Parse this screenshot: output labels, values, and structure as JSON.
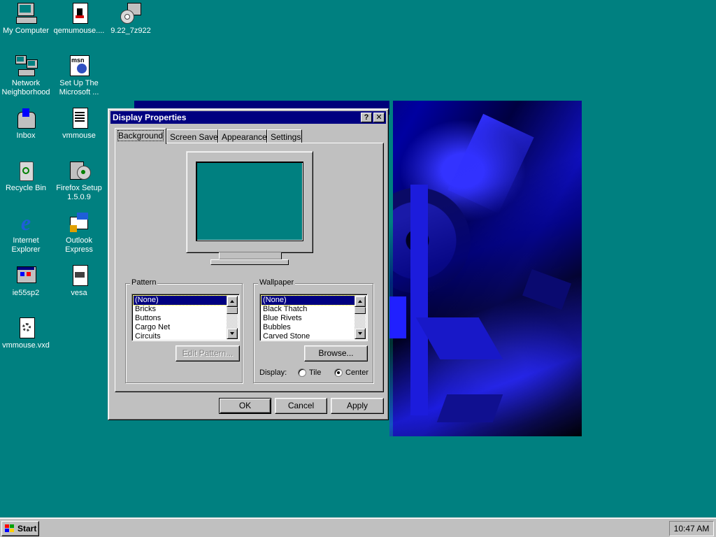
{
  "desktop": {
    "icons": [
      {
        "label": "My Computer",
        "icon": "my-computer-icon"
      },
      {
        "label": "qemumouse....",
        "icon": "document-icon"
      },
      {
        "label": "9.22_7z922",
        "icon": "installer-icon"
      },
      {
        "label": "Network Neighborhood",
        "icon": "network-icon"
      },
      {
        "label": "Set Up The Microsoft ...",
        "icon": "msn-icon"
      },
      {
        "label": "Inbox",
        "icon": "inbox-icon"
      },
      {
        "label": "vmmouse",
        "icon": "text-file-icon"
      },
      {
        "label": "Recycle Bin",
        "icon": "recycle-bin-icon"
      },
      {
        "label": "Firefox Setup 1.5.0.9",
        "icon": "setup-icon"
      },
      {
        "label": "Internet Explorer",
        "icon": "internet-explorer-icon"
      },
      {
        "label": "Outlook Express",
        "icon": "outlook-express-icon"
      },
      {
        "label": "ie55sp2",
        "icon": "program-icon"
      },
      {
        "label": "vesa",
        "icon": "text-file-icon"
      },
      {
        "label": "vmmouse.vxd",
        "icon": "system-file-icon"
      }
    ]
  },
  "dialog": {
    "title": "Display Properties",
    "help_label": "?",
    "close_label": "✕",
    "tabs": [
      {
        "label": "Background",
        "active": true
      },
      {
        "label": "Screen Saver",
        "active": false
      },
      {
        "label": "Appearance",
        "active": false
      },
      {
        "label": "Settings",
        "active": false
      }
    ],
    "pattern": {
      "legend": "Pattern",
      "items": [
        "(None)",
        "Bricks",
        "Buttons",
        "Cargo Net",
        "Circuits"
      ],
      "selected": "(None)",
      "edit_button": "Edit Pattern..."
    },
    "wallpaper": {
      "legend": "Wallpaper",
      "items": [
        "(None)",
        "Black Thatch",
        "Blue Rivets",
        "Bubbles",
        "Carved Stone"
      ],
      "selected": "(None)",
      "browse_button": "Browse...",
      "display_label": "Display:",
      "tile_label": "Tile",
      "center_label": "Center",
      "display_mode": "Center"
    },
    "buttons": {
      "ok": "OK",
      "cancel": "Cancel",
      "apply": "Apply"
    }
  },
  "taskbar": {
    "start_label": "Start",
    "clock": "10:47 AM"
  },
  "colors": {
    "desktop": "#008080",
    "titlebar": "#000080",
    "face": "#c0c0c0"
  }
}
